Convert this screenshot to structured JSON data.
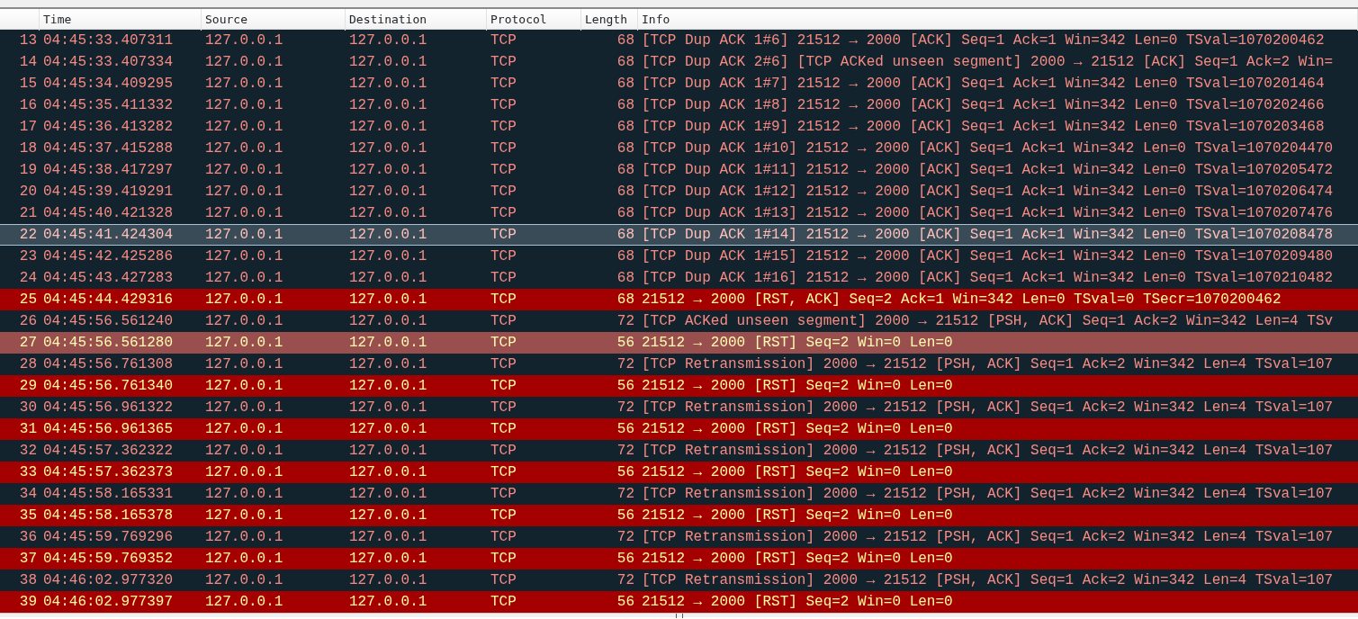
{
  "columns": [
    {
      "label": "Time"
    },
    {
      "label": "Source"
    },
    {
      "label": "Destination"
    },
    {
      "label": "Protocol"
    },
    {
      "label": "Length"
    },
    {
      "label": "Info"
    }
  ],
  "rows": [
    {
      "no": "13",
      "time": "04:45:33.407311",
      "source": "127.0.0.1",
      "destination": "127.0.0.1",
      "protocol": "TCP",
      "length": "68",
      "info": "[TCP Dup ACK 1#6] 21512 → 2000 [ACK] Seq=1 Ack=1 Win=342 Len=0 TSval=1070200462",
      "kind": "warning",
      "selected": false,
      "hovered": false
    },
    {
      "no": "14",
      "time": "04:45:33.407334",
      "source": "127.0.0.1",
      "destination": "127.0.0.1",
      "protocol": "TCP",
      "length": "68",
      "info": "[TCP Dup ACK 2#6] [TCP ACKed unseen segment] 2000 → 21512 [ACK] Seq=1 Ack=2 Win=",
      "kind": "warning",
      "selected": false,
      "hovered": false
    },
    {
      "no": "15",
      "time": "04:45:34.409295",
      "source": "127.0.0.1",
      "destination": "127.0.0.1",
      "protocol": "TCP",
      "length": "68",
      "info": "[TCP Dup ACK 1#7] 21512 → 2000 [ACK] Seq=1 Ack=1 Win=342 Len=0 TSval=1070201464",
      "kind": "warning",
      "selected": false,
      "hovered": false
    },
    {
      "no": "16",
      "time": "04:45:35.411332",
      "source": "127.0.0.1",
      "destination": "127.0.0.1",
      "protocol": "TCP",
      "length": "68",
      "info": "[TCP Dup ACK 1#8] 21512 → 2000 [ACK] Seq=1 Ack=1 Win=342 Len=0 TSval=1070202466",
      "kind": "warning",
      "selected": false,
      "hovered": false
    },
    {
      "no": "17",
      "time": "04:45:36.413282",
      "source": "127.0.0.1",
      "destination": "127.0.0.1",
      "protocol": "TCP",
      "length": "68",
      "info": "[TCP Dup ACK 1#9] 21512 → 2000 [ACK] Seq=1 Ack=1 Win=342 Len=0 TSval=1070203468",
      "kind": "warning",
      "selected": false,
      "hovered": false
    },
    {
      "no": "18",
      "time": "04:45:37.415288",
      "source": "127.0.0.1",
      "destination": "127.0.0.1",
      "protocol": "TCP",
      "length": "68",
      "info": "[TCP Dup ACK 1#10] 21512 → 2000 [ACK] Seq=1 Ack=1 Win=342 Len=0 TSval=1070204470",
      "kind": "warning",
      "selected": false,
      "hovered": false
    },
    {
      "no": "19",
      "time": "04:45:38.417297",
      "source": "127.0.0.1",
      "destination": "127.0.0.1",
      "protocol": "TCP",
      "length": "68",
      "info": "[TCP Dup ACK 1#11] 21512 → 2000 [ACK] Seq=1 Ack=1 Win=342 Len=0 TSval=1070205472",
      "kind": "warning",
      "selected": false,
      "hovered": false
    },
    {
      "no": "20",
      "time": "04:45:39.419291",
      "source": "127.0.0.1",
      "destination": "127.0.0.1",
      "protocol": "TCP",
      "length": "68",
      "info": "[TCP Dup ACK 1#12] 21512 → 2000 [ACK] Seq=1 Ack=1 Win=342 Len=0 TSval=1070206474",
      "kind": "warning",
      "selected": false,
      "hovered": false
    },
    {
      "no": "21",
      "time": "04:45:40.421328",
      "source": "127.0.0.1",
      "destination": "127.0.0.1",
      "protocol": "TCP",
      "length": "68",
      "info": "[TCP Dup ACK 1#13] 21512 → 2000 [ACK] Seq=1 Ack=1 Win=342 Len=0 TSval=1070207476",
      "kind": "warning",
      "selected": false,
      "hovered": false
    },
    {
      "no": "22",
      "time": "04:45:41.424304",
      "source": "127.0.0.1",
      "destination": "127.0.0.1",
      "protocol": "TCP",
      "length": "68",
      "info": "[TCP Dup ACK 1#14] 21512 → 2000 [ACK] Seq=1 Ack=1 Win=342 Len=0 TSval=1070208478",
      "kind": "warning",
      "selected": true,
      "hovered": false
    },
    {
      "no": "23",
      "time": "04:45:42.425286",
      "source": "127.0.0.1",
      "destination": "127.0.0.1",
      "protocol": "TCP",
      "length": "68",
      "info": "[TCP Dup ACK 1#15] 21512 → 2000 [ACK] Seq=1 Ack=1 Win=342 Len=0 TSval=1070209480",
      "kind": "warning",
      "selected": false,
      "hovered": false
    },
    {
      "no": "24",
      "time": "04:45:43.427283",
      "source": "127.0.0.1",
      "destination": "127.0.0.1",
      "protocol": "TCP",
      "length": "68",
      "info": "[TCP Dup ACK 1#16] 21512 → 2000 [ACK] Seq=1 Ack=1 Win=342 Len=0 TSval=1070210482",
      "kind": "warning",
      "selected": false,
      "hovered": false
    },
    {
      "no": "25",
      "time": "04:45:44.429316",
      "source": "127.0.0.1",
      "destination": "127.0.0.1",
      "protocol": "TCP",
      "length": "68",
      "info": "21512 → 2000 [RST, ACK] Seq=2 Ack=1 Win=342 Len=0 TSval=0 TSecr=1070200462",
      "kind": "error",
      "selected": false,
      "hovered": false
    },
    {
      "no": "26",
      "time": "04:45:56.561240",
      "source": "127.0.0.1",
      "destination": "127.0.0.1",
      "protocol": "TCP",
      "length": "72",
      "info": "[TCP ACKed unseen segment] 2000 → 21512 [PSH, ACK] Seq=1 Ack=2 Win=342 Len=4 TSv",
      "kind": "warning",
      "selected": false,
      "hovered": false
    },
    {
      "no": "27",
      "time": "04:45:56.561280",
      "source": "127.0.0.1",
      "destination": "127.0.0.1",
      "protocol": "TCP",
      "length": "56",
      "info": "21512 → 2000 [RST] Seq=2 Win=0 Len=0",
      "kind": "error",
      "selected": false,
      "hovered": true
    },
    {
      "no": "28",
      "time": "04:45:56.761308",
      "source": "127.0.0.1",
      "destination": "127.0.0.1",
      "protocol": "TCP",
      "length": "72",
      "info": "[TCP Retransmission] 2000 → 21512 [PSH, ACK] Seq=1 Ack=2 Win=342 Len=4 TSval=107",
      "kind": "warning",
      "selected": false,
      "hovered": false
    },
    {
      "no": "29",
      "time": "04:45:56.761340",
      "source": "127.0.0.1",
      "destination": "127.0.0.1",
      "protocol": "TCP",
      "length": "56",
      "info": "21512 → 2000 [RST] Seq=2 Win=0 Len=0",
      "kind": "error",
      "selected": false,
      "hovered": false
    },
    {
      "no": "30",
      "time": "04:45:56.961322",
      "source": "127.0.0.1",
      "destination": "127.0.0.1",
      "protocol": "TCP",
      "length": "72",
      "info": "[TCP Retransmission] 2000 → 21512 [PSH, ACK] Seq=1 Ack=2 Win=342 Len=4 TSval=107",
      "kind": "warning",
      "selected": false,
      "hovered": false
    },
    {
      "no": "31",
      "time": "04:45:56.961365",
      "source": "127.0.0.1",
      "destination": "127.0.0.1",
      "protocol": "TCP",
      "length": "56",
      "info": "21512 → 2000 [RST] Seq=2 Win=0 Len=0",
      "kind": "error",
      "selected": false,
      "hovered": false
    },
    {
      "no": "32",
      "time": "04:45:57.362322",
      "source": "127.0.0.1",
      "destination": "127.0.0.1",
      "protocol": "TCP",
      "length": "72",
      "info": "[TCP Retransmission] 2000 → 21512 [PSH, ACK] Seq=1 Ack=2 Win=342 Len=4 TSval=107",
      "kind": "warning",
      "selected": false,
      "hovered": false
    },
    {
      "no": "33",
      "time": "04:45:57.362373",
      "source": "127.0.0.1",
      "destination": "127.0.0.1",
      "protocol": "TCP",
      "length": "56",
      "info": "21512 → 2000 [RST] Seq=2 Win=0 Len=0",
      "kind": "error",
      "selected": false,
      "hovered": false
    },
    {
      "no": "34",
      "time": "04:45:58.165331",
      "source": "127.0.0.1",
      "destination": "127.0.0.1",
      "protocol": "TCP",
      "length": "72",
      "info": "[TCP Retransmission] 2000 → 21512 [PSH, ACK] Seq=1 Ack=2 Win=342 Len=4 TSval=107",
      "kind": "warning",
      "selected": false,
      "hovered": false
    },
    {
      "no": "35",
      "time": "04:45:58.165378",
      "source": "127.0.0.1",
      "destination": "127.0.0.1",
      "protocol": "TCP",
      "length": "56",
      "info": "21512 → 2000 [RST] Seq=2 Win=0 Len=0",
      "kind": "error",
      "selected": false,
      "hovered": false
    },
    {
      "no": "36",
      "time": "04:45:59.769296",
      "source": "127.0.0.1",
      "destination": "127.0.0.1",
      "protocol": "TCP",
      "length": "72",
      "info": "[TCP Retransmission] 2000 → 21512 [PSH, ACK] Seq=1 Ack=2 Win=342 Len=4 TSval=107",
      "kind": "warning",
      "selected": false,
      "hovered": false
    },
    {
      "no": "37",
      "time": "04:45:59.769352",
      "source": "127.0.0.1",
      "destination": "127.0.0.1",
      "protocol": "TCP",
      "length": "56",
      "info": "21512 → 2000 [RST] Seq=2 Win=0 Len=0",
      "kind": "error",
      "selected": false,
      "hovered": false
    },
    {
      "no": "38",
      "time": "04:46:02.977320",
      "source": "127.0.0.1",
      "destination": "127.0.0.1",
      "protocol": "TCP",
      "length": "72",
      "info": "[TCP Retransmission] 2000 → 21512 [PSH, ACK] Seq=1 Ack=2 Win=342 Len=4 TSval=107",
      "kind": "warning",
      "selected": false,
      "hovered": false
    },
    {
      "no": "39",
      "time": "04:46:02.977397",
      "source": "127.0.0.1",
      "destination": "127.0.0.1",
      "protocol": "TCP",
      "length": "56",
      "info": "21512 → 2000 [RST] Seq=2 Win=0 Len=0",
      "kind": "error",
      "selected": false,
      "hovered": false
    }
  ]
}
